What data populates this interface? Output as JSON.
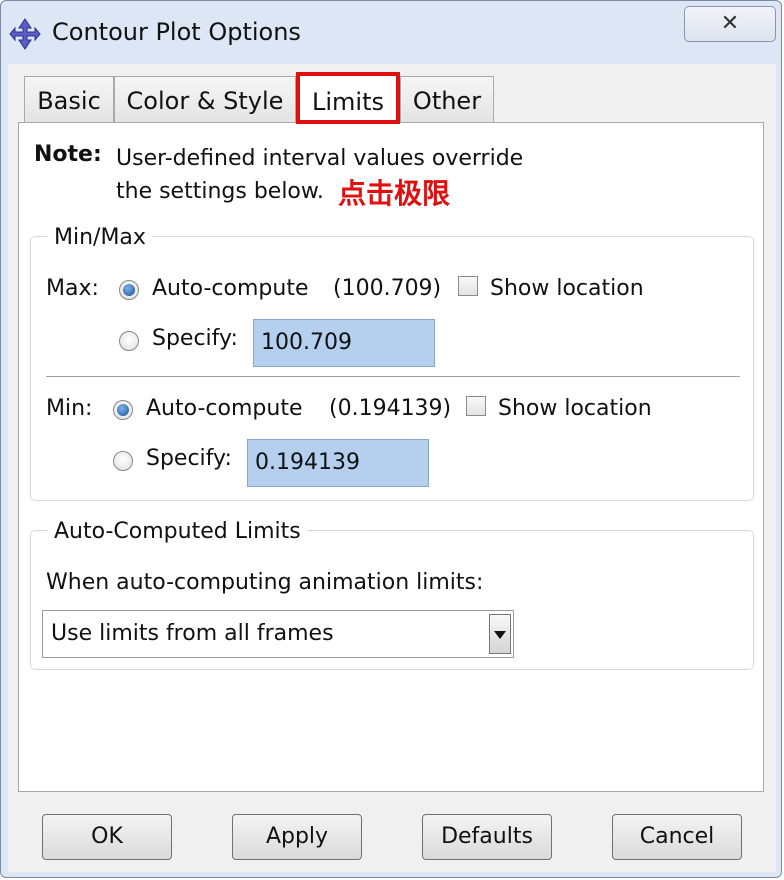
{
  "window": {
    "title": "Contour Plot Options",
    "close_glyph": "✕",
    "icon": "diamond-arrows-icon"
  },
  "tabs": [
    {
      "label": "Basic",
      "active": false
    },
    {
      "label": "Color & Style",
      "active": false
    },
    {
      "label": "Limits",
      "active": true
    },
    {
      "label": "Other",
      "active": false
    }
  ],
  "note": {
    "label": "Note:",
    "line1": "User-defined interval values override",
    "line2": "the settings below.",
    "annotation": "点击极限"
  },
  "minmax": {
    "title": "Min/Max",
    "max": {
      "label": "Max:",
      "auto_label": "Auto-compute",
      "auto_value": "(100.709)",
      "show_location": "Show location",
      "specify_label": "Specify:",
      "specify_value": "100.709",
      "auto_selected": true,
      "show_location_checked": false
    },
    "min": {
      "label": "Min:",
      "auto_label": "Auto-compute",
      "auto_value": "(0.194139)",
      "show_location": "Show location",
      "specify_label": "Specify:",
      "specify_value": "0.194139",
      "auto_selected": true,
      "show_location_checked": false
    }
  },
  "auto_limits": {
    "title": "Auto-Computed Limits",
    "prompt": "When auto-computing animation limits:",
    "selected": "Use limits from all frames"
  },
  "buttons": {
    "ok": "OK",
    "apply": "Apply",
    "defaults": "Defaults",
    "cancel": "Cancel"
  },
  "colors": {
    "highlight": "#e01010",
    "field_bg": "#b4d0ee",
    "radio_selected": "#16508f"
  }
}
